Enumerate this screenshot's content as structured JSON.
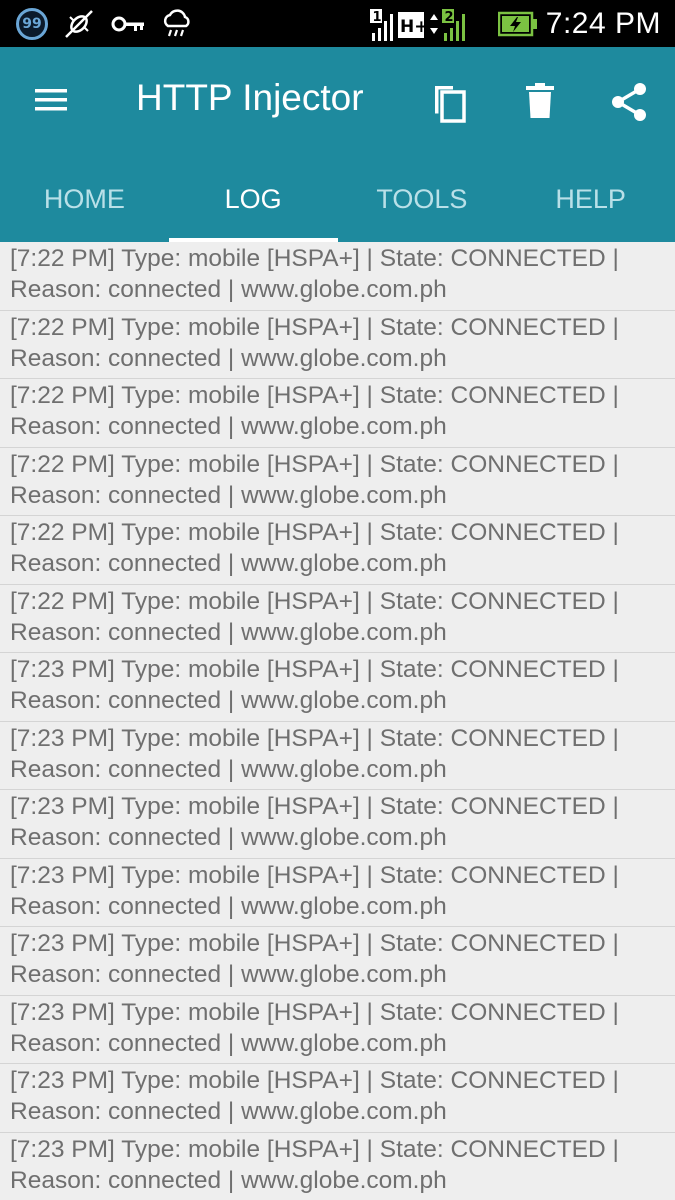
{
  "status_bar": {
    "notification_badge": "99",
    "network_type": "H+",
    "sim1": "1",
    "sim2": "2",
    "time": "7:24 PM",
    "icons": [
      "badge-icon",
      "debug-icon",
      "key-icon",
      "weather-icon",
      "signal-icon",
      "battery-icon"
    ]
  },
  "appbar": {
    "title": "HTTP Injector",
    "color": "#1e8a9e",
    "actions": [
      "copy-icon",
      "delete-icon",
      "share-icon"
    ]
  },
  "tabs": [
    {
      "label": "HOME",
      "active": false
    },
    {
      "label": "LOG",
      "active": true
    },
    {
      "label": "TOOLS",
      "active": false
    },
    {
      "label": "HELP",
      "active": false
    }
  ],
  "log": [
    {
      "line1": "[7:22 PM] Type: mobile [HSPA+] | State: CONNECTED |",
      "line2": "Reason: connected | www.globe.com.ph"
    },
    {
      "line1": "[7:22 PM] Type: mobile [HSPA+] | State: CONNECTED |",
      "line2": "Reason: connected | www.globe.com.ph"
    },
    {
      "line1": "[7:22 PM] Type: mobile [HSPA+] | State: CONNECTED |",
      "line2": "Reason: connected | www.globe.com.ph"
    },
    {
      "line1": "[7:22 PM] Type: mobile [HSPA+] | State: CONNECTED |",
      "line2": "Reason: connected | www.globe.com.ph"
    },
    {
      "line1": "[7:22 PM] Type: mobile [HSPA+] | State: CONNECTED |",
      "line2": "Reason: connected | www.globe.com.ph"
    },
    {
      "line1": "[7:22 PM] Type: mobile [HSPA+] | State: CONNECTED |",
      "line2": "Reason: connected | www.globe.com.ph"
    },
    {
      "line1": "[7:23 PM] Type: mobile [HSPA+] | State: CONNECTED |",
      "line2": "Reason: connected | www.globe.com.ph"
    },
    {
      "line1": "[7:23 PM] Type: mobile [HSPA+] | State: CONNECTED |",
      "line2": "Reason: connected | www.globe.com.ph"
    },
    {
      "line1": "[7:23 PM] Type: mobile [HSPA+] | State: CONNECTED |",
      "line2": "Reason: connected | www.globe.com.ph"
    },
    {
      "line1": "[7:23 PM] Type: mobile [HSPA+] | State: CONNECTED |",
      "line2": "Reason: connected | www.globe.com.ph"
    },
    {
      "line1": "[7:23 PM] Type: mobile [HSPA+] | State: CONNECTED |",
      "line2": "Reason: connected | www.globe.com.ph"
    },
    {
      "line1": "[7:23 PM] Type: mobile [HSPA+] | State: CONNECTED |",
      "line2": "Reason: connected | www.globe.com.ph"
    },
    {
      "line1": "[7:23 PM] Type: mobile [HSPA+] | State: CONNECTED |",
      "line2": "Reason: connected | www.globe.com.ph"
    },
    {
      "line1": "[7:23 PM] Type: mobile [HSPA+] | State: CONNECTED |",
      "line2": "Reason: connected | www.globe.com.ph"
    }
  ]
}
